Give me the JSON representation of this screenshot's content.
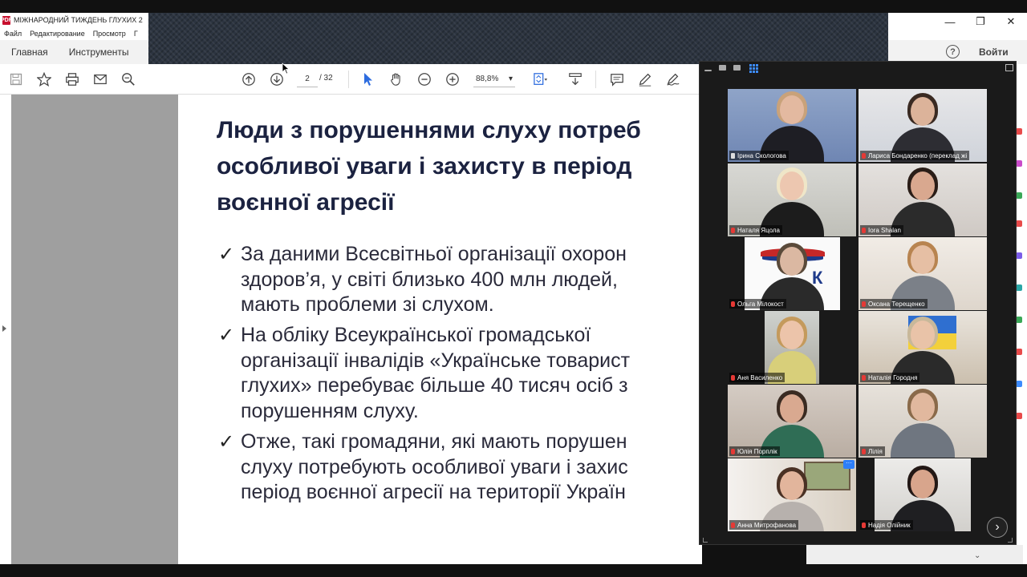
{
  "acrobat": {
    "title": "МІЖНАРОДНИЙ ТИЖДЕНЬ ГЛУХИХ 2",
    "pdf_icon": "PDF",
    "menu": [
      "Файл",
      "Редактирование",
      "Просмотр",
      "Г"
    ],
    "tabs": [
      "Главная",
      "Инструменты"
    ],
    "login": "Войти",
    "help": "?",
    "page_current": "2",
    "page_total": "/ 32",
    "zoom": "88,8%",
    "zoom_arrow": "▾",
    "win_minimize": "—",
    "win_restore": "❐",
    "win_close": "✕",
    "scroll_down": "⌄"
  },
  "slide": {
    "title_lines": [
      "Люди з порушеннями слуху потреб",
      "особливої уваги і захисту в період",
      "воєнної агресії"
    ],
    "check": "✓",
    "bullets": [
      [
        "За даними Всесвітньої організації охорон",
        "здоров’я, у світі близько 400 млн людей,",
        "мають проблеми зі слухом."
      ],
      [
        "На обліку Всеукраїнської громадської",
        "організації інвалідів «Українське товарист",
        "глухих» перебуває більше 40 тисяч осіб з",
        "порушенням слуху."
      ],
      [
        "Отже, такі  громадяни, які мають порушен",
        "слуху потребують особливої уваги і захис",
        "період воєнної агресії на території Україн"
      ]
    ]
  },
  "zoom": {
    "more": "···",
    "next": "›",
    "participants": [
      {
        "name": "Ірина Скологова",
        "muted": false,
        "active": true
      },
      {
        "name": "Лариса Бондаренко (переклад жі",
        "muted": true
      },
      {
        "name": "Наталя Яцола",
        "muted": true
      },
      {
        "name": "Iora Shalan",
        "muted": true
      },
      {
        "name": "Ольга Мілокост",
        "muted": true
      },
      {
        "name": "Оксана Терещенко",
        "muted": true
      },
      {
        "name": "Аня Василенко",
        "muted": true
      },
      {
        "name": "Наталія Городня",
        "muted": true
      },
      {
        "name": "Юлія Порплік",
        "muted": true
      },
      {
        "name": "Лілія",
        "muted": true
      },
      {
        "name": "Анна Митрофанова",
        "muted": true
      },
      {
        "name": "Надія Олійник",
        "muted": true
      }
    ]
  }
}
